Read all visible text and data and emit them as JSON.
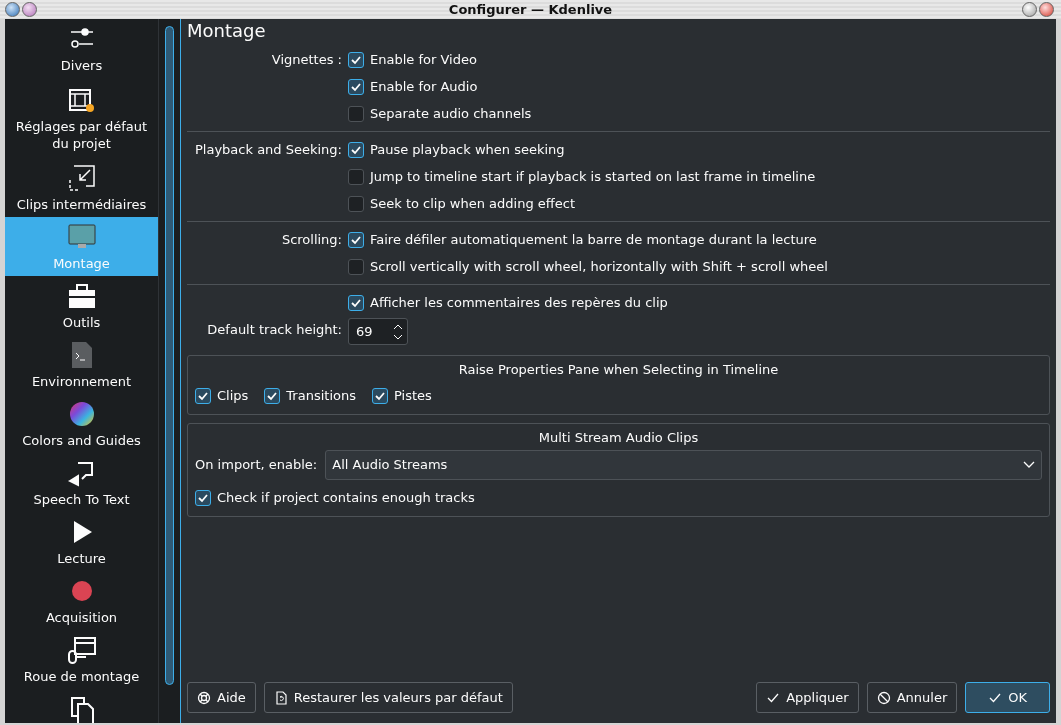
{
  "window": {
    "title": "Configurer — Kdenlive"
  },
  "sidebar": {
    "items": [
      {
        "kind": "sliders",
        "label": "Divers",
        "selected": false
      },
      {
        "kind": "film",
        "label": "Réglages par défaut du projet",
        "selected": false
      },
      {
        "kind": "proxy",
        "label": "Clips intermédiaires",
        "selected": false
      },
      {
        "kind": "monitor",
        "label": "Montage",
        "selected": true
      },
      {
        "kind": "toolbox",
        "label": "Outils",
        "selected": false
      },
      {
        "kind": "terminal",
        "label": "Environnement",
        "selected": false
      },
      {
        "kind": "colorwheel",
        "label": "Colors and Guides",
        "selected": false
      },
      {
        "kind": "speech",
        "label": "Speech To Text",
        "selected": false
      },
      {
        "kind": "play",
        "label": "Lecture",
        "selected": false
      },
      {
        "kind": "record",
        "label": "Acquisition",
        "selected": false
      },
      {
        "kind": "wheel",
        "label": "Roue de montage",
        "selected": false
      },
      {
        "kind": "pages"
      }
    ]
  },
  "page": {
    "title": "Montage",
    "sections": [
      {
        "label": "Vignettes :",
        "options": [
          {
            "label": "Enable for Video",
            "checked": true
          },
          {
            "label": "Enable for Audio",
            "checked": true
          },
          {
            "label": "Separate audio channels",
            "checked": false
          }
        ]
      },
      {
        "label": "Playback and Seeking:",
        "options": [
          {
            "label": "Pause playback when seeking",
            "checked": true
          },
          {
            "label": "Jump to timeline start if playback is started on last frame in timeline",
            "checked": false
          },
          {
            "label": "Seek to clip when adding effect",
            "checked": false
          }
        ]
      },
      {
        "label": "Scrolling:",
        "options": [
          {
            "label": "Faire défiler automatiquement la barre de montage durant la lecture",
            "checked": true
          },
          {
            "label": "Scroll vertically with scroll wheel, horizontally with Shift + scroll wheel",
            "checked": false
          }
        ]
      },
      {
        "options": [
          {
            "label": "Afficher les commentaires des repères du clip",
            "checked": true
          }
        ]
      }
    ],
    "track_height": {
      "label": "Default track height:",
      "value": "69"
    },
    "raise_group": {
      "title": "Raise Properties Pane when Selecting in Timeline",
      "options": [
        {
          "label": "Clips",
          "checked": true
        },
        {
          "label": "Transitions",
          "checked": true
        },
        {
          "label": "Pistes",
          "checked": true
        }
      ]
    },
    "audio_group": {
      "title": "Multi Stream Audio Clips",
      "select": {
        "label": "On import, enable:",
        "value": "All Audio Streams"
      },
      "options": [
        {
          "label": "Check if project contains enough tracks",
          "checked": true
        }
      ]
    }
  },
  "buttons_left": [
    {
      "kind": "help",
      "label": "Aide",
      "default": false
    },
    {
      "kind": "restore",
      "label": "Restaurer les valeurs par défaut",
      "default": false
    }
  ],
  "buttons_right": [
    {
      "kind": "apply",
      "label": "Appliquer",
      "default": false
    },
    {
      "kind": "cancel",
      "label": "Annuler",
      "default": false
    },
    {
      "kind": "ok",
      "label": "OK",
      "default": true
    }
  ]
}
